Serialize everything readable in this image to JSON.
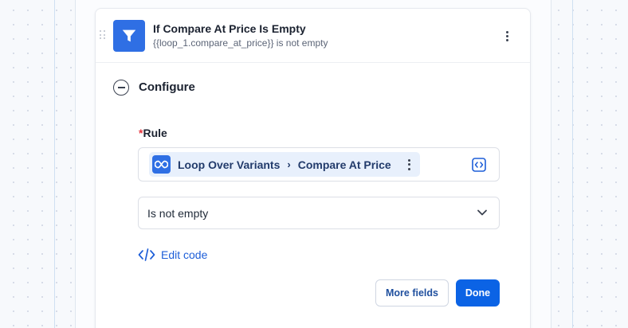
{
  "step": {
    "title": "If Compare At Price Is Empty",
    "subtitle": "{{loop_1.compare_at_price}} is not empty",
    "icon": "filter-icon",
    "accent": "#2f6fe4"
  },
  "configure": {
    "section_title": "Configure",
    "rule": {
      "required_marker": "*",
      "label": "Rule",
      "pill": {
        "icon": "loop-icon",
        "source": "Loop Over Variants",
        "separator": "›",
        "field": "Compare At Price"
      }
    },
    "condition": {
      "value": "Is not empty"
    },
    "edit_code_label": "Edit code",
    "buttons": {
      "more_fields": "More fields",
      "done": "Done"
    }
  },
  "colors": {
    "primary": "#0b63e5",
    "link": "#1d5ed8",
    "required": "#e5343d",
    "pill_bg": "#e8f0fc"
  }
}
